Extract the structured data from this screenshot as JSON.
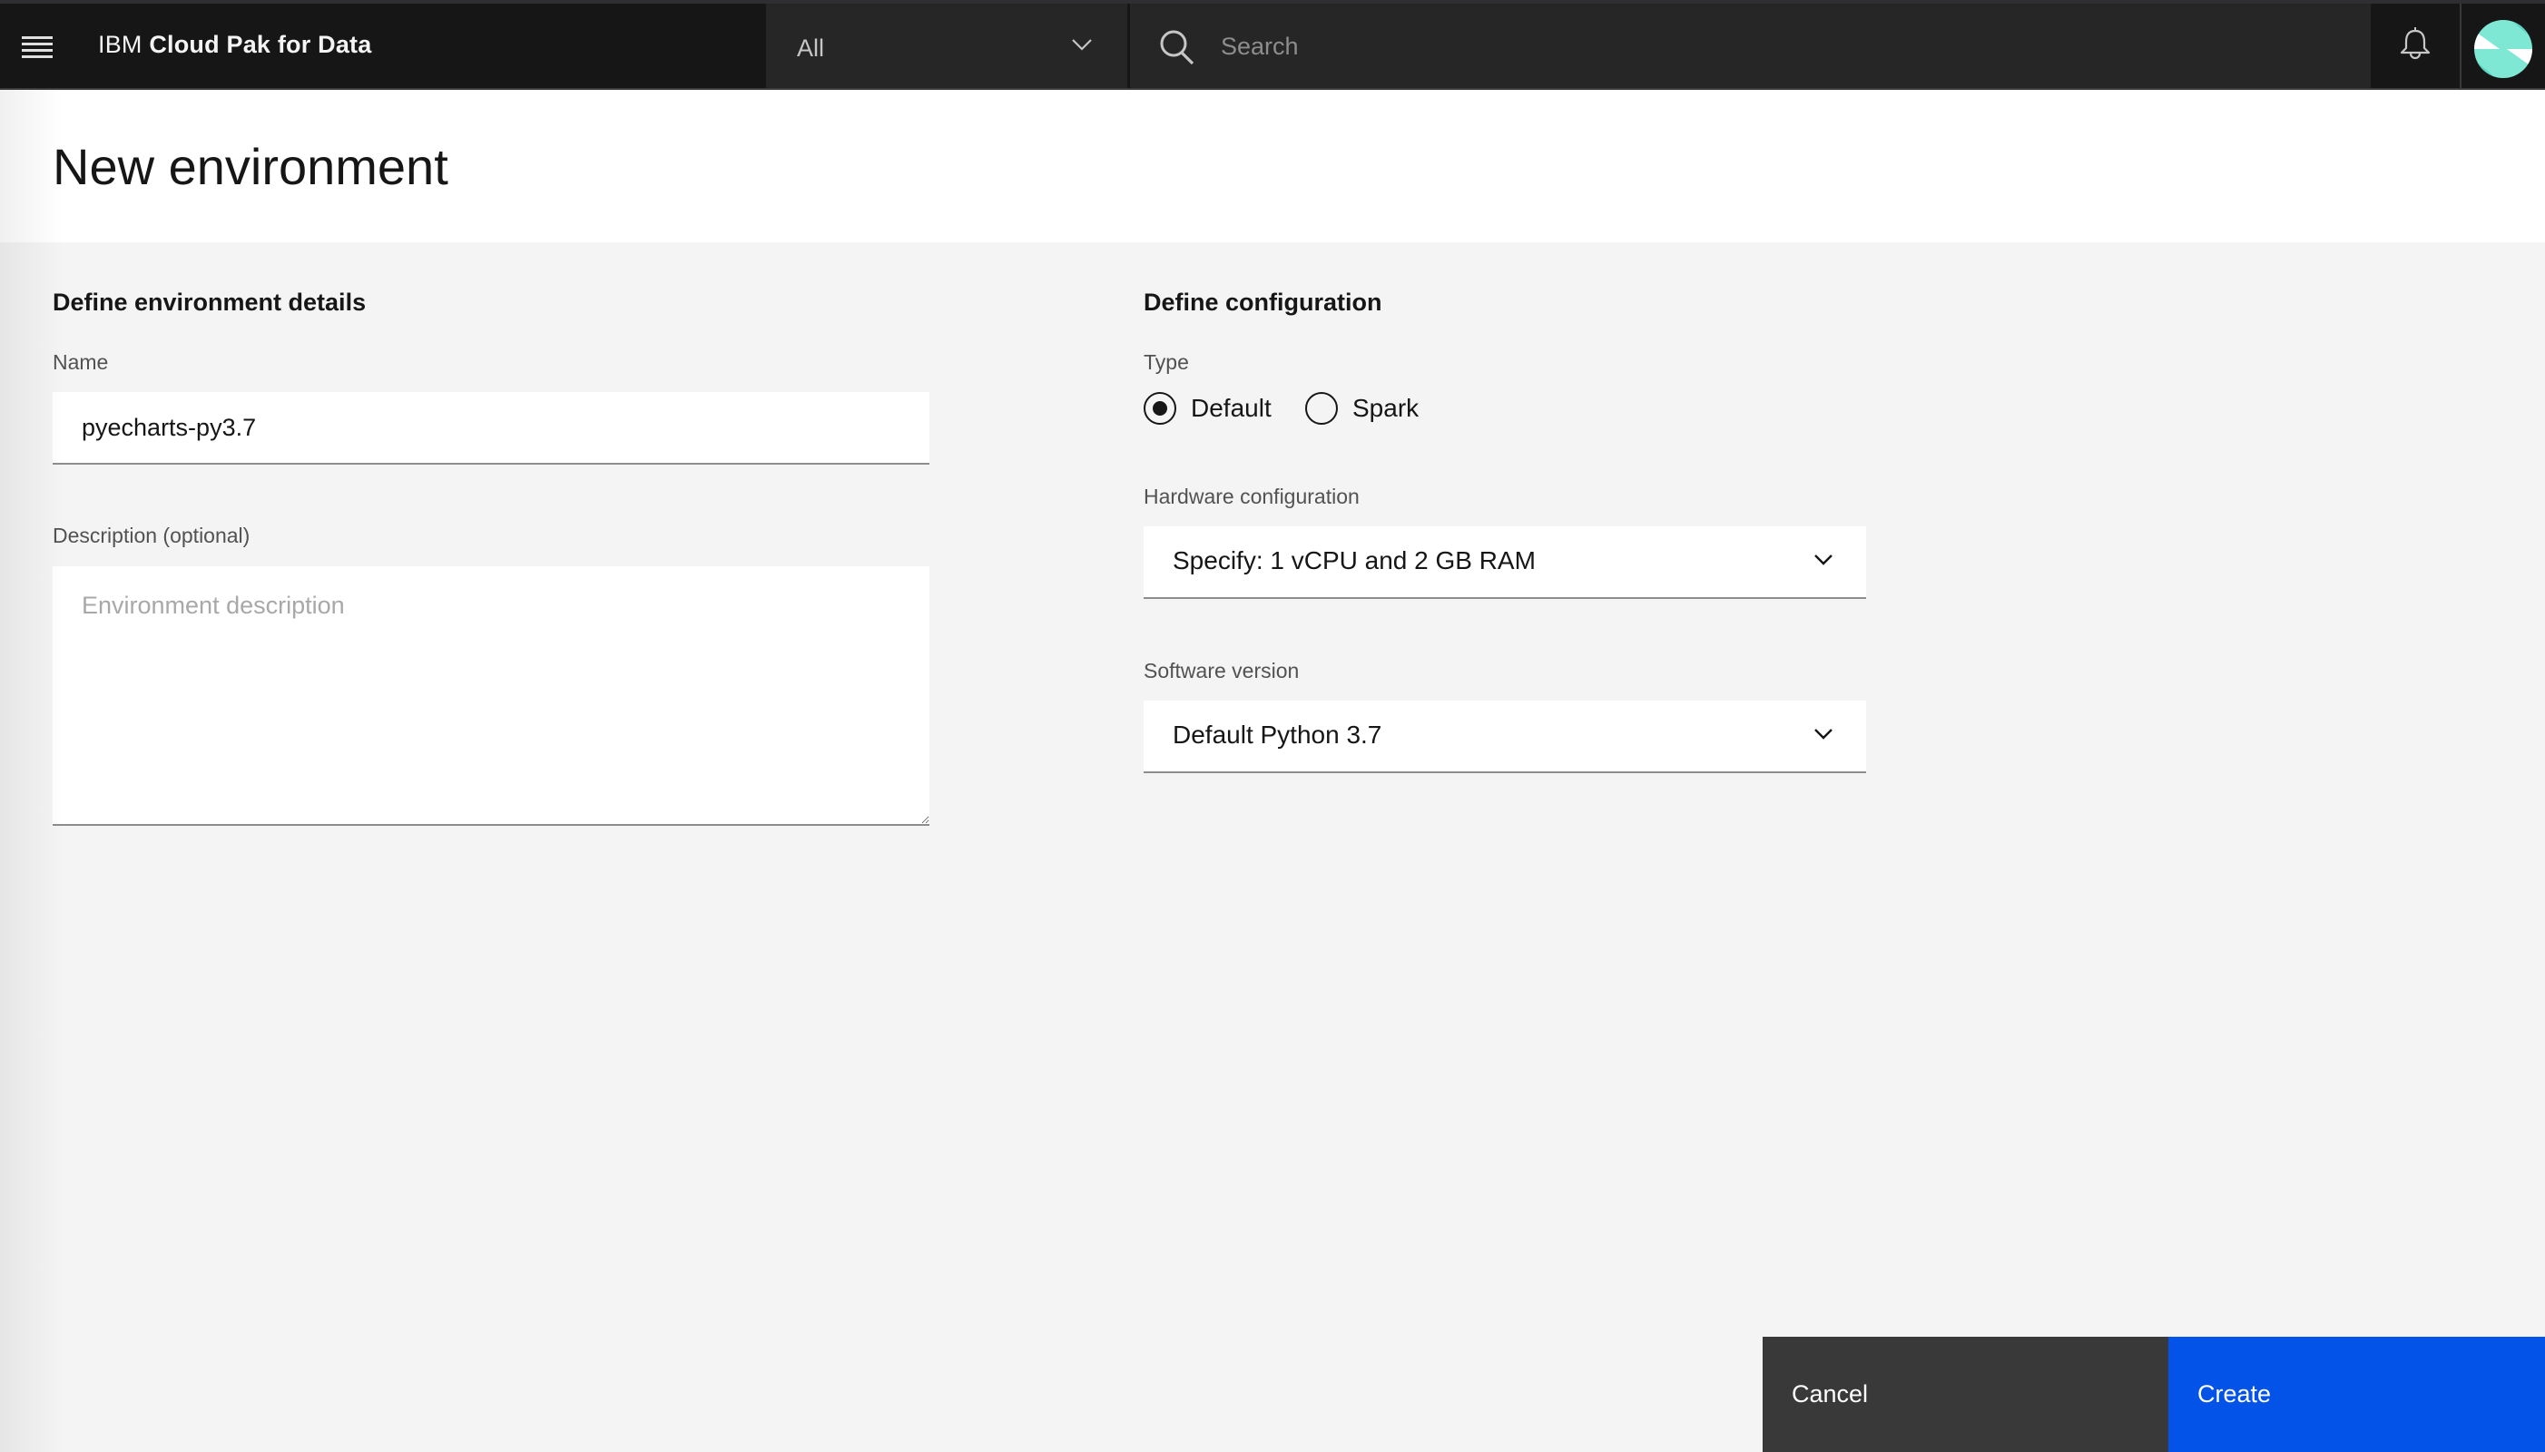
{
  "header": {
    "brand_prefix": "IBM",
    "brand_name": "Cloud Pak for Data",
    "scope_dropdown": {
      "selected": "All"
    },
    "search": {
      "placeholder": "Search",
      "value": ""
    },
    "icons": [
      "menu-icon",
      "chevron-down-icon",
      "search-icon",
      "notification-bell-icon",
      "user-avatar"
    ]
  },
  "page": {
    "title": "New environment"
  },
  "details": {
    "section_title": "Define environment details",
    "name": {
      "label": "Name",
      "value": "pyecharts-py3.7"
    },
    "description": {
      "label": "Description (optional)",
      "placeholder": "Environment description",
      "value": ""
    }
  },
  "configuration": {
    "section_title": "Define configuration",
    "type": {
      "label": "Type",
      "options": [
        {
          "label": "Default",
          "selected": true
        },
        {
          "label": "Spark",
          "selected": false
        }
      ]
    },
    "hardware": {
      "label": "Hardware configuration",
      "selected": "Specify: 1 vCPU and 2 GB RAM"
    },
    "software": {
      "label": "Software version",
      "selected": "Default Python 3.7"
    }
  },
  "actions": {
    "cancel_label": "Cancel",
    "create_label": "Create"
  },
  "colors": {
    "header_bg": "#161616",
    "primary": "#0353e9",
    "secondary": "#393939",
    "page_bg": "#f4f4f4"
  }
}
